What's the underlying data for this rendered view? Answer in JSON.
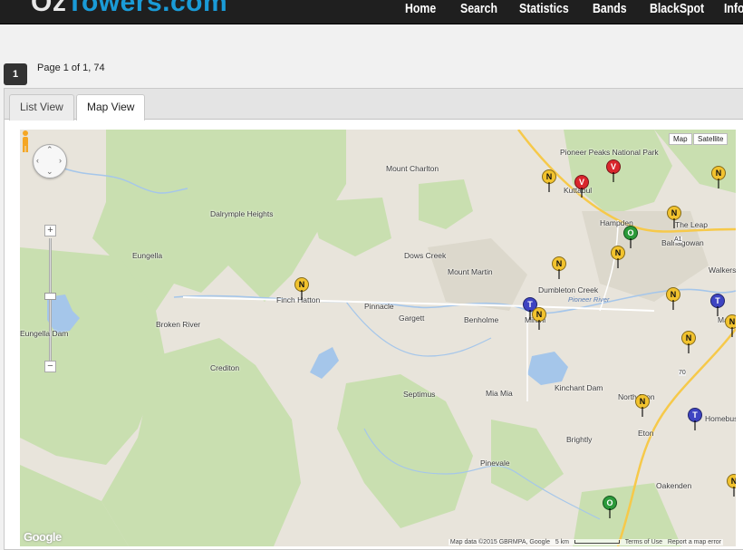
{
  "header": {
    "logo_prefix": "Oz",
    "logo_accent": "Towers.com",
    "nav": [
      "Home",
      "Search",
      "Statistics",
      "Bands",
      "BlackSpot",
      "Info"
    ]
  },
  "pagination": {
    "current_page": "1",
    "summary": "Page 1 of 1, 74"
  },
  "tabs": [
    "List View",
    "Map View"
  ],
  "active_tab": "Map View",
  "map": {
    "type_buttons": [
      "Map",
      "Satellite"
    ],
    "zoom_in": "+",
    "zoom_out": "−",
    "places": [
      "Mount Charlton",
      "Dalrymple Heights",
      "Eungella",
      "Dows Creek",
      "Mount Martin",
      "Finch Hatton",
      "Pinnacle",
      "Gargett",
      "Benholme",
      "Broken River",
      "Eungella Dam",
      "Crediton",
      "Septimus",
      "Mia Mia",
      "Kinchant Dam",
      "Brightly",
      "Pinevale",
      "Eton",
      "Oakenden",
      "Hampden",
      "The Leap",
      "Balnagowan",
      "Kuttabul",
      "Dumbleton Creek",
      "Mirani",
      "Homebush",
      "Marian",
      "Pioneer Peaks National Park",
      "North Eton",
      "Walkerston"
    ],
    "river_label": "Pioneer River",
    "road_labels": [
      "A1",
      "70"
    ],
    "markers": [
      {
        "letter": "N",
        "color": "#f2c32e"
      },
      {
        "letter": "V",
        "color": "#d9262c"
      },
      {
        "letter": "V",
        "color": "#d9262c"
      },
      {
        "letter": "N",
        "color": "#f2c32e"
      },
      {
        "letter": "N",
        "color": "#f2c32e"
      },
      {
        "letter": "O",
        "color": "#2b9a3a"
      },
      {
        "letter": "N",
        "color": "#f2c32e"
      },
      {
        "letter": "N",
        "color": "#f2c32e"
      },
      {
        "letter": "T",
        "color": "#3e44c2"
      },
      {
        "letter": "N",
        "color": "#f2c32e"
      },
      {
        "letter": "N",
        "color": "#f2c32e"
      },
      {
        "letter": "T",
        "color": "#3e44c2"
      },
      {
        "letter": "N",
        "color": "#f2c32e"
      },
      {
        "letter": "N",
        "color": "#f2c32e"
      },
      {
        "letter": "N",
        "color": "#f2c32e"
      },
      {
        "letter": "T",
        "color": "#3e44c2"
      },
      {
        "letter": "N",
        "color": "#f2c32e"
      },
      {
        "letter": "O",
        "color": "#2b9a3a"
      },
      {
        "letter": "N",
        "color": "#f2c32e"
      }
    ],
    "attribution": "Map data ©2015 GBRMPA, Google",
    "scale": "5 km",
    "terms": "Terms of Use",
    "report": "Report a map error",
    "google_logo": "Google",
    "colors": {
      "land": "#e8e4db",
      "forest": "#c9dfb0",
      "water": "#a5c6ea",
      "road_major": "#f6c94a",
      "road_minor": "#ffffff"
    }
  }
}
